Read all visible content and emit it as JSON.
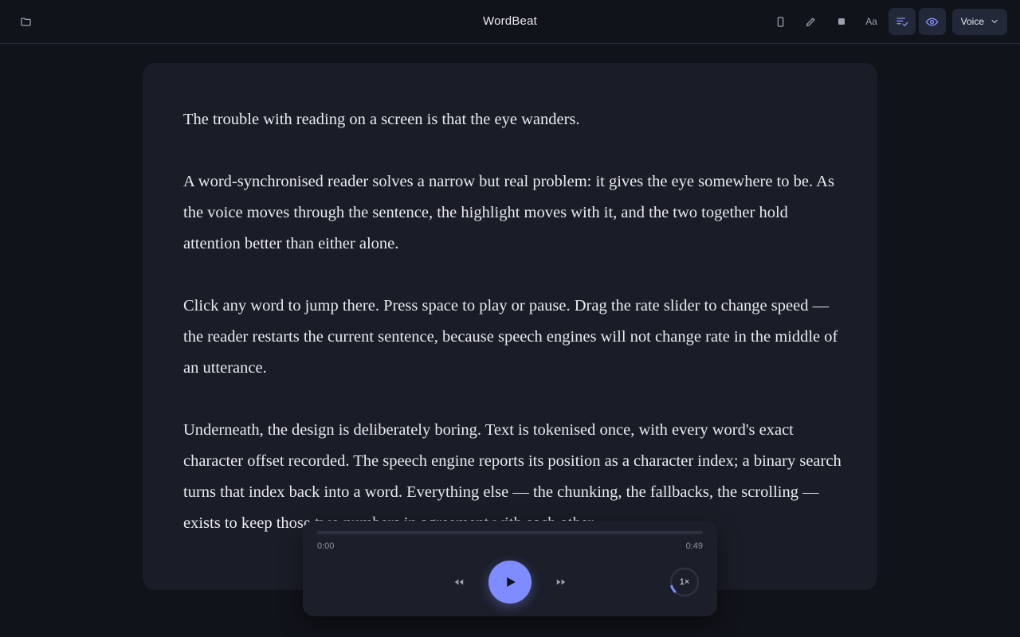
{
  "app": {
    "title": "WordBeat"
  },
  "toolbar": {
    "icons": [
      "folder-icon",
      "phone-icon",
      "pencil-icon",
      "stop-icon",
      "font-size-icon",
      "list-check-icon",
      "eye-icon",
      "chevron-down-icon"
    ],
    "font_label": "Aa",
    "voice_label": "Voice",
    "active_color": "#7f8cff"
  },
  "document": {
    "paragraphs": [
      "The trouble with reading on a screen is that the eye wanders.",
      "A word-synchronised reader solves a narrow but real problem: it gives the eye somewhere to be. As the voice moves through the sentence, the highlight moves with it, and the two together hold attention better than either alone.",
      "Click any word to jump there. Press space to play or pause. Drag the rate slider to change speed — the reader restarts the current sentence, because speech engines will not change rate in the middle of an utterance.",
      "Underneath, the design is deliberately boring. Text is tokenised once, with every word's exact character offset recorded. The speech engine reports its position as a character index; a binary search turns that index back into a word. Everything else — the chunking, the fallbacks, the scrolling — exists to keep those two numbers in agreement with each other."
    ]
  },
  "player": {
    "current_time": "0:00",
    "duration": "0:49",
    "progress": 0,
    "rate_label": "1×",
    "rate_fraction": 0.1,
    "accent": "#7f8cff"
  }
}
